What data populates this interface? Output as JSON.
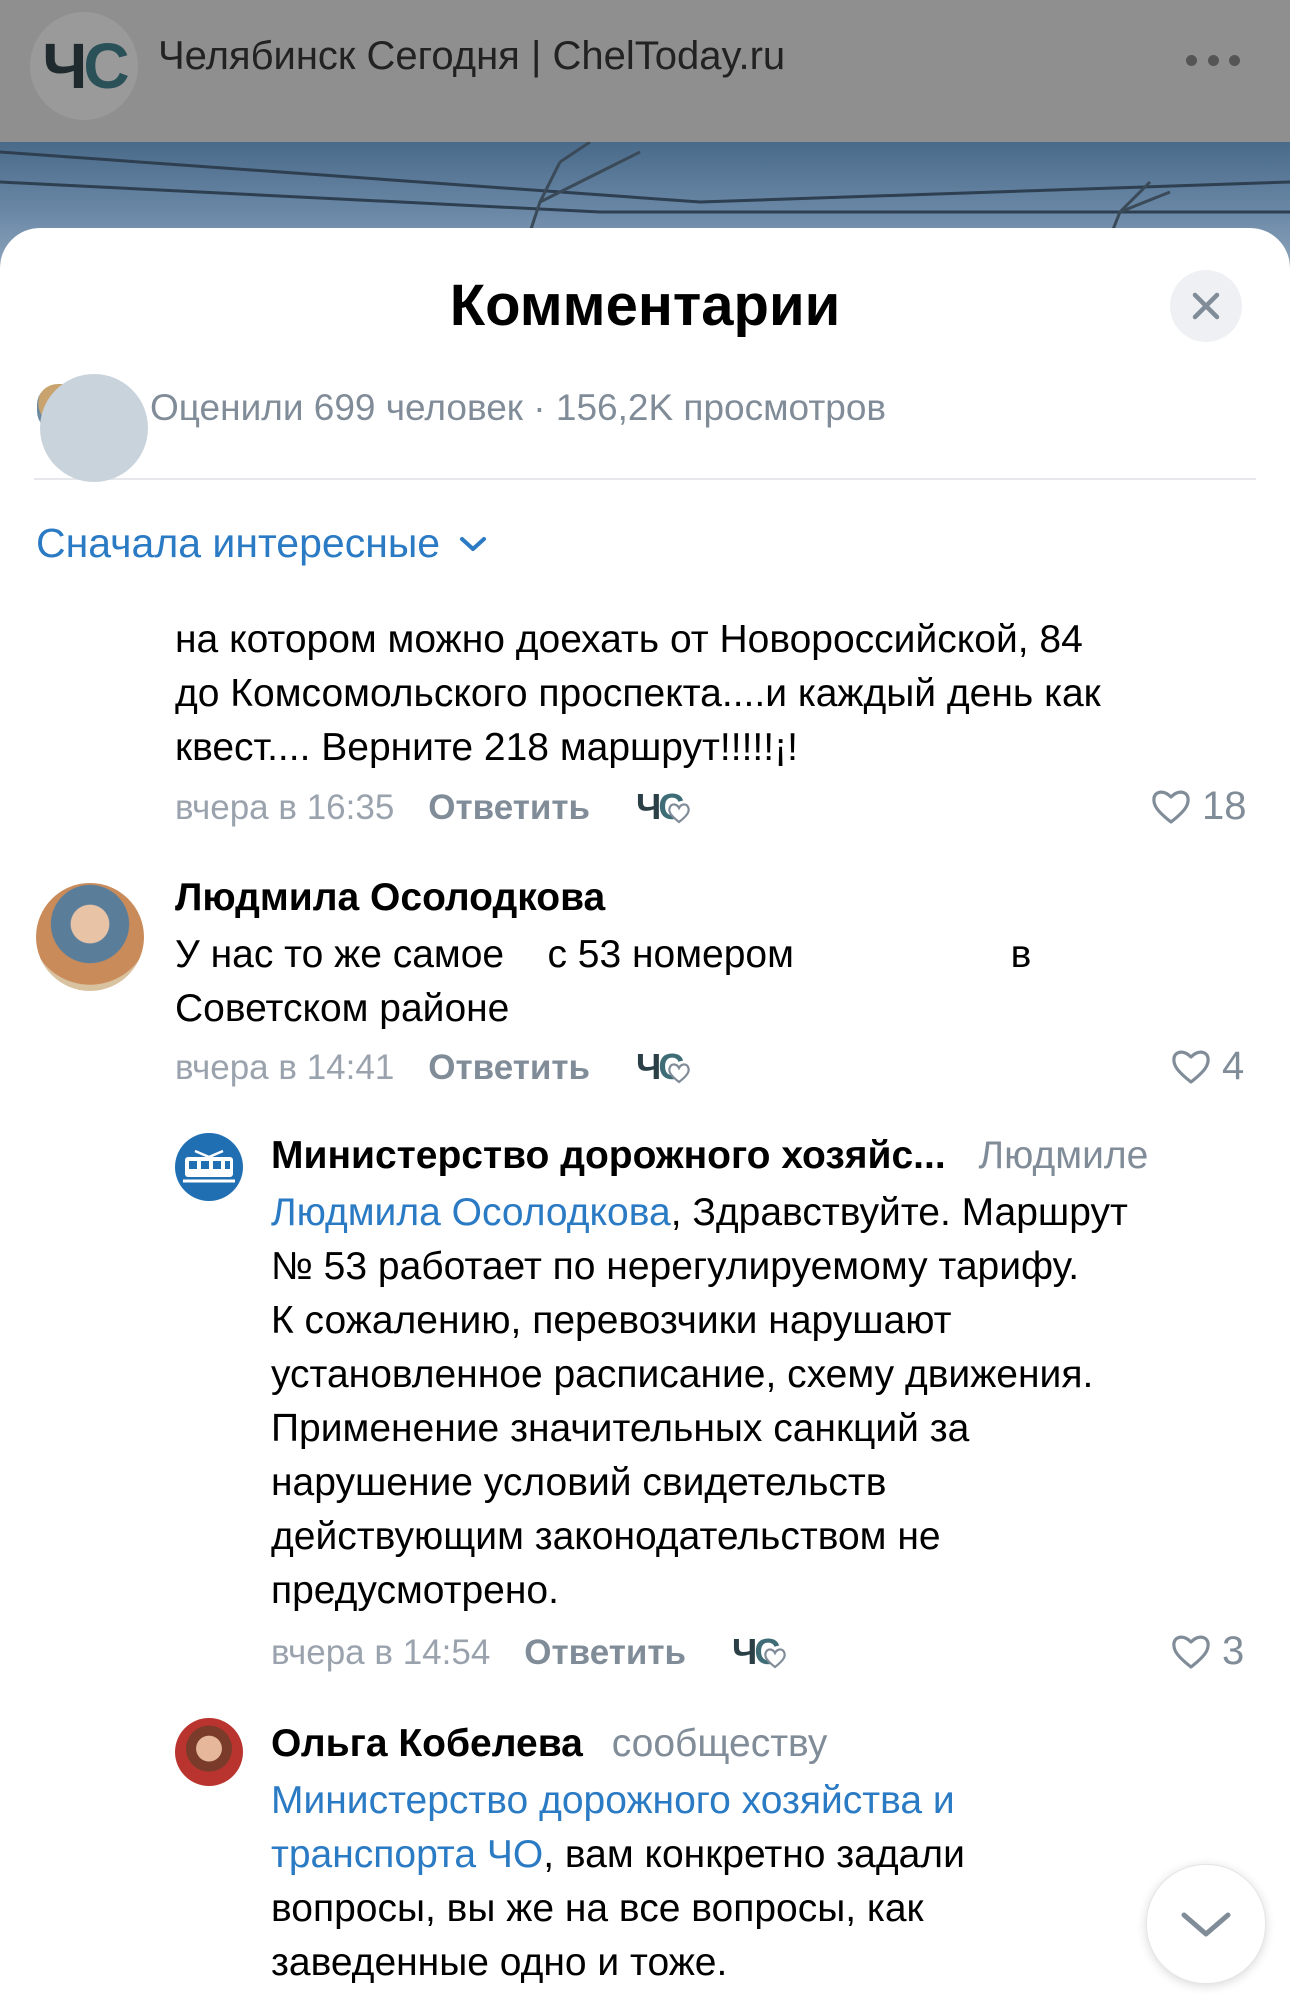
{
  "header": {
    "logo_text_1": "Ч",
    "logo_text_2": "С",
    "title": "Челябинск Сегодня | ChelToday.ru"
  },
  "sheet": {
    "title": "Комментарии",
    "likes_text": "Оценили 699 человек · 156,2K просмотров",
    "sort_label": "Сначала интересные"
  },
  "comments": [
    {
      "lines": [
        "на котором можно доехать от  Новороссийской, 84",
        "до Комсомольского проспекта....и каждый день как",
        "квест.... Верните 218 маршрут!!!!!¡!"
      ],
      "time": "вчера в 16:35",
      "reply": "Ответить",
      "likes": "18"
    },
    {
      "author": "Людмила Осолодкова",
      "lines": [
        "У нас то же самое    с 53 номером                    в",
        "Советском районе"
      ],
      "time": "вчера в 14:41",
      "reply": "Ответить",
      "likes": "4"
    },
    {
      "author": "Министерство дорожного хозяйс...",
      "addressee": "Людмиле",
      "mention": "Людмила Осолодкова",
      "first_line_rest": ", Здравствуйте. Маршрут",
      "lines": [
        "№ 53 работает по нерегулируемому тарифу.",
        "К сожалению, перевозчики нарушают",
        "установленное расписание, схему движения.",
        "Применение значительных санкций за",
        "нарушение условий свидетельств",
        "действующим законодательством не",
        "предусмотрено."
      ],
      "time": "вчера в 14:54",
      "reply": "Ответить",
      "likes": "3"
    },
    {
      "author": "Ольга Кобелева",
      "addressee": "сообществу",
      "mention_line_1": "Министерство дорожного хозяйства и",
      "mention_line_2": "транспорта ЧО",
      "second_line_rest": ", вам конкретно задали",
      "lines": [
        "вопросы, вы же на все вопросы, как",
        "заведенные одно и тоже."
      ]
    }
  ],
  "icons": {
    "close": "close-icon",
    "more": "more-icon",
    "chevron": "chevron-down-icon",
    "heart": "heart-icon"
  },
  "colors": {
    "accent": "#2a7ac4",
    "muted": "#818c99",
    "sheet_bg": "#ffffff"
  }
}
